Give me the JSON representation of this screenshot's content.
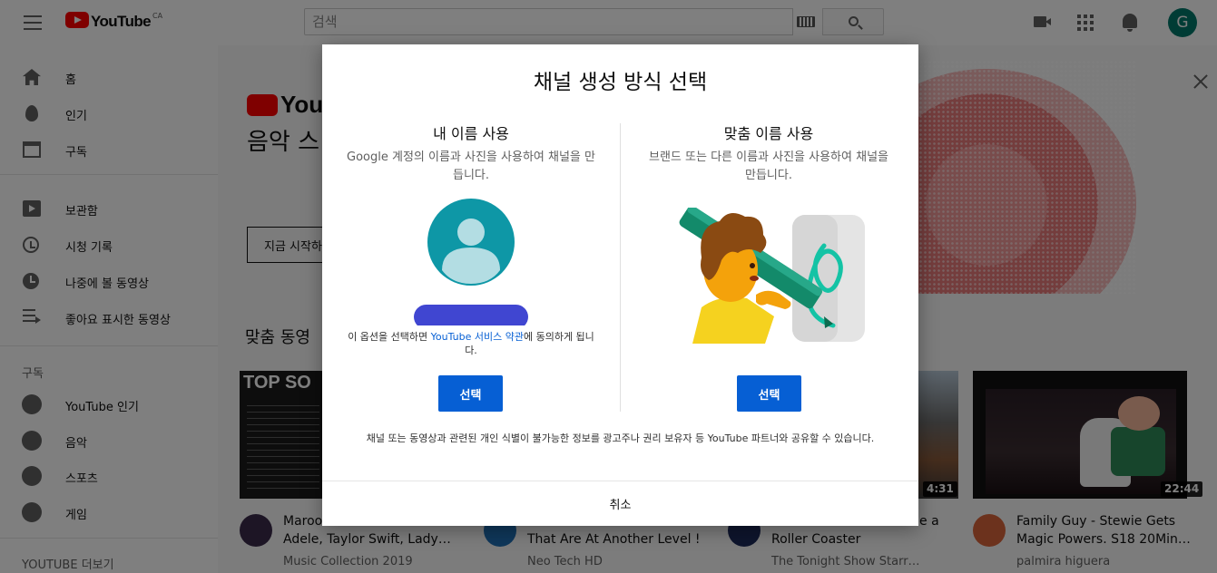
{
  "header": {
    "logo_text": "YouTube",
    "logo_country": "CA",
    "search_placeholder": "검색",
    "avatar_letter": "G"
  },
  "sidebar": {
    "main_items": [
      {
        "label": "홈",
        "icon": "home-icon"
      },
      {
        "label": "인기",
        "icon": "trending-icon"
      },
      {
        "label": "구독",
        "icon": "subscriptions-icon"
      }
    ],
    "library_items": [
      {
        "label": "보관함",
        "icon": "library-icon"
      },
      {
        "label": "시청 기록",
        "icon": "history-icon"
      },
      {
        "label": "나중에 볼 동영상",
        "icon": "watch-later-icon"
      },
      {
        "label": "좋아요 표시한 동영상",
        "icon": "liked-videos-icon"
      }
    ],
    "subscriptions_title": "구독",
    "subscription_items": [
      {
        "label": "YouTube 인기",
        "icon": "youtube-trending-channel-icon"
      },
      {
        "label": "음악",
        "icon": "music-channel-icon"
      },
      {
        "label": "스포츠",
        "icon": "sports-channel-icon"
      },
      {
        "label": "게임",
        "icon": "gaming-channel-icon"
      }
    ],
    "more_title": "YOUTUBE 더보기"
  },
  "main": {
    "banner_logo_text": "YouTube",
    "banner_title": "음악 스",
    "banner_button": "지금 시작하",
    "recommended_title": "맞춤 동영",
    "thumb1_text": "TOP SO",
    "videos": [
      {
        "title_lines": [
          "Maroo",
          "Adele, Taylor Swift, Lady…"
        ],
        "channel": "Music Collection 2019",
        "duration": ""
      },
      {
        "title_lines": [
          "",
          "That Are At Another Level !"
        ],
        "channel": "Neo Tech HD",
        "duration": ""
      },
      {
        "title_lines": [
          "e a",
          "Roller Coaster"
        ],
        "channel": "The Tonight Show Starr…",
        "duration": "4:31"
      },
      {
        "title_lines": [
          "Family Guy - Stewie Gets",
          "Magic Powers. S18 20Min…"
        ],
        "channel": "palmira higuera",
        "duration": "22:44"
      }
    ]
  },
  "dialog": {
    "title": "채널 생성 방식 선택",
    "left": {
      "title": "내 이름 사용",
      "description": "Google 계정의 이름과 사진을 사용하여 채널을 만듭니다.",
      "terms_prefix": "이 옵션을 선택하면 ",
      "terms_link": "YouTube 서비스 약관",
      "terms_suffix": "에 동의하게 됩니다.",
      "button": "선택"
    },
    "right": {
      "title": "맞춤 이름 사용",
      "description": "브랜드 또는 다른 이름과 사진을 사용하여 채널을 만듭니다.",
      "button": "선택"
    },
    "footer": "채널 또는 동영상과 관련된 개인 식별이 불가능한 정보를 광고주나 권리 보유자 등 YouTube 파트너와 공유할 수 있습니다.",
    "cancel": "취소"
  },
  "colors": {
    "accent_blue": "#065fd4",
    "youtube_red": "#ff0000",
    "avatar_bg": "#00796b",
    "person_circle": "#0e97a6",
    "name_bar": "#4046d1"
  }
}
